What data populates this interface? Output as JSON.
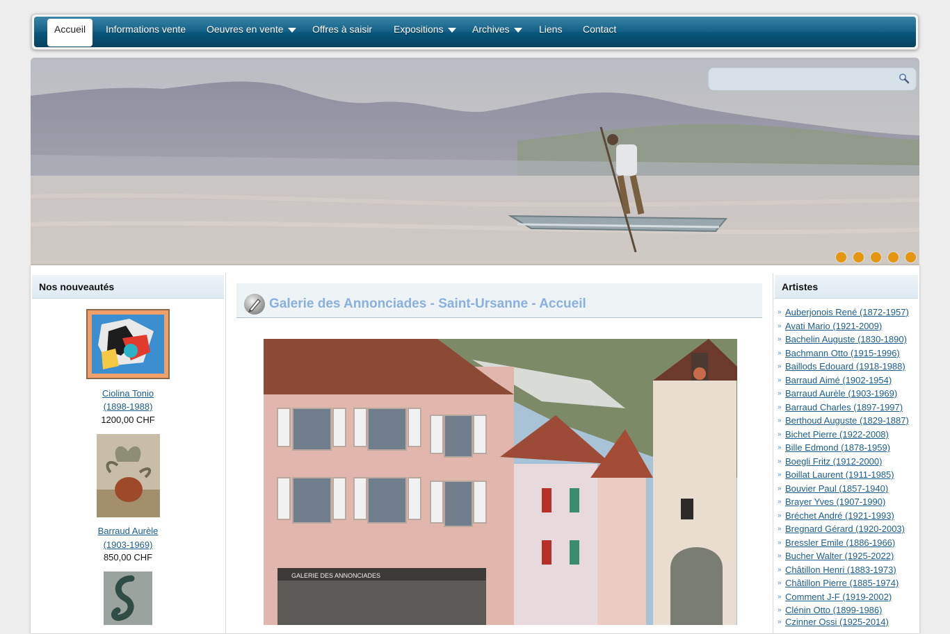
{
  "nav": {
    "items": [
      {
        "label": "Accueil",
        "active": true,
        "has_submenu": false
      },
      {
        "label": "Informations vente",
        "active": false,
        "has_submenu": false
      },
      {
        "label": "Oeuvres en vente",
        "active": false,
        "has_submenu": true
      },
      {
        "label": "Offres à saisir",
        "active": false,
        "has_submenu": false
      },
      {
        "label": "Expositions",
        "active": false,
        "has_submenu": true
      },
      {
        "label": "Archives",
        "active": false,
        "has_submenu": true
      },
      {
        "label": "Liens",
        "active": false,
        "has_submenu": false
      },
      {
        "label": "Contact",
        "active": false,
        "has_submenu": false
      }
    ]
  },
  "search": {
    "value": "",
    "icon": "search-icon"
  },
  "slider": {
    "dot_count": 5,
    "dot_color": "#e49610"
  },
  "left_sidebar": {
    "title": "Nos nouveautés",
    "items": [
      {
        "artist": "Ciolina Tonio",
        "dates": "(1898-1988)",
        "price": "1200,00 CHF"
      },
      {
        "artist": "Barraud Aurèle",
        "dates": "(1903-1969)",
        "price": "850,00 CHF"
      }
    ]
  },
  "main": {
    "title": "Galerie des Annonciades - Saint-Ursanne - Accueil",
    "title_color": "#8ab0df",
    "shop_sign": "GALERIE DES ANNONCIADES"
  },
  "right_sidebar": {
    "title": "Artistes",
    "artists": [
      "Auberjonois René (1872-1957)",
      "Avati Mario (1921-2009)",
      "Bachelin Auguste (1830-1890)",
      "Bachmann Otto (1915-1996)",
      "Baillods Edouard (1918-1988)",
      "Barraud Aimé (1902-1954)",
      "Barraud Aurèle (1903-1969)",
      "Barraud Charles (1897-1997)",
      "Berthoud Auguste (1829-1887)",
      "Bichet Pierre (1922-2008)",
      "Bille Edmond (1878-1959)",
      "Boegli Fritz (1912-2000)",
      "Boillat Laurent (1911-1985)",
      "Bouvier Paul (1857-1940)",
      "Brayer Yves (1907-1990)",
      "Bréchet André (1921-1993)",
      "Bregnard Gérard (1920-2003)",
      "Bressler Emile (1886-1966)",
      "Bucher Walter (1925-2022)",
      "Châtillon Henri (1883-1973)",
      "Châtillon Pierre (1885-1974)",
      "Comment J-F (1919-2002)",
      "Clénin Otto (1899-1986)",
      "Czinner Ossi (1925-2014)"
    ]
  },
  "colors": {
    "nav_blue": "#0a5a82",
    "link": "#1b5d8c",
    "bullet": "#4d8fbe"
  }
}
